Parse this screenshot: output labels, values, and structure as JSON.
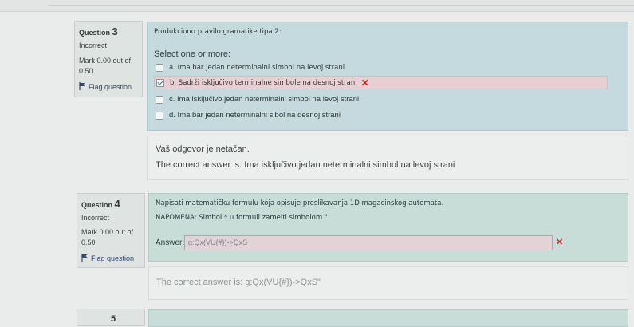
{
  "q3": {
    "label": "Question",
    "number": "3",
    "state": "Incorrect",
    "mark_line1": "Mark 0.00 out of",
    "mark_line2": "0.50",
    "flag": "Flag question",
    "text": "Produkciono pravilo gramatike tipa 2:",
    "prompt": "Select one or more:",
    "options": [
      {
        "label": "a. Ima bar jedan neterminalni simbol na levoj strani",
        "checked": false,
        "wrong": false
      },
      {
        "label": "b. Sadrži isključivo terminalne simbole na desnoj strani",
        "checked": true,
        "wrong": true
      },
      {
        "label": "c. Ima isključivo jedan neterminalni simbol na levoj strani",
        "checked": false,
        "wrong": false
      },
      {
        "label": "d. Ima bar jedan neterminalni sibol na desnoj strani",
        "checked": false,
        "wrong": false
      }
    ],
    "feedback": "Vaš odgovor je netačan.",
    "correct_answer": "The correct answer is: Ima isključivo jedan neterminalni simbol na levoj strani"
  },
  "q4": {
    "label": "Question",
    "number": "4",
    "state": "Incorrect",
    "mark_line1": "Mark 0.00 out of",
    "mark_line2": "0.50",
    "flag": "Flag question",
    "text": "Napisati matematičku formulu koja opisuje preslikavanja 1D magacinskog automata.",
    "note": "NAPOMENA: Simbol * u formuli zameiti simbolom \".",
    "answer_label": "Answer:",
    "answer_value": "g:Qx(VU{#})->QxS",
    "correct_answer": "The correct answer is: g:Qx(VU{#})->QxS\""
  },
  "q5": {
    "number": "5"
  },
  "colors": {
    "incorrect": "#cf2a2a",
    "formulation_bg": "#c5dade",
    "wrong_option_bg": "#e8cfd3"
  }
}
